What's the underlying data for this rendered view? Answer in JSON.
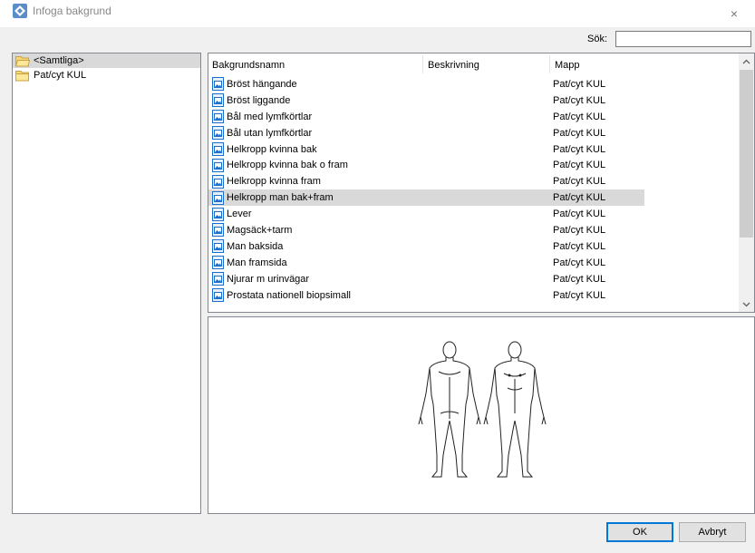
{
  "window": {
    "title": "Infoga bakgrund",
    "close_glyph": "×",
    "app_icon": "diamond-app-icon"
  },
  "search": {
    "label": "Sök:",
    "value": "",
    "placeholder": ""
  },
  "tree": {
    "items": [
      {
        "label": "<Samtliga>",
        "icon": "folder-open-icon",
        "selected": true
      },
      {
        "label": "Pat/cyt KUL",
        "icon": "folder-icon",
        "selected": false
      }
    ]
  },
  "list": {
    "columns": [
      "Bakgrundsnamn",
      "Beskrivning",
      "Mapp"
    ],
    "rows": [
      {
        "name": "Bröst hängande",
        "description": "",
        "folder": "Pat/cyt KUL"
      },
      {
        "name": "Bröst liggande",
        "description": "",
        "folder": "Pat/cyt KUL"
      },
      {
        "name": "Bål med lymfkörtlar",
        "description": "",
        "folder": "Pat/cyt KUL"
      },
      {
        "name": "Bål utan lymfkörtlar",
        "description": "",
        "folder": "Pat/cyt KUL"
      },
      {
        "name": "Helkropp kvinna bak",
        "description": "",
        "folder": "Pat/cyt KUL"
      },
      {
        "name": "Helkropp kvinna bak o fram",
        "description": "",
        "folder": "Pat/cyt KUL"
      },
      {
        "name": "Helkropp kvinna fram",
        "description": "",
        "folder": "Pat/cyt KUL"
      },
      {
        "name": "Helkropp man bak+fram",
        "description": "",
        "folder": "Pat/cyt KUL",
        "selected": true
      },
      {
        "name": "Lever",
        "description": "",
        "folder": "Pat/cyt KUL"
      },
      {
        "name": "Magsäck+tarm",
        "description": "",
        "folder": "Pat/cyt KUL"
      },
      {
        "name": "Man baksida",
        "description": "",
        "folder": "Pat/cyt KUL"
      },
      {
        "name": "Man framsida",
        "description": "",
        "folder": "Pat/cyt KUL"
      },
      {
        "name": "Njurar m urinvägar",
        "description": "",
        "folder": "Pat/cyt KUL"
      },
      {
        "name": "Prostata nationell biopsimall",
        "description": "",
        "folder": "Pat/cyt KUL"
      }
    ]
  },
  "preview": {
    "image": "male-body-back-and-front-outline"
  },
  "buttons": {
    "ok": "OK",
    "cancel": "Avbryt"
  },
  "colors": {
    "selection": "#d9d9d9",
    "ok_border": "#0078d7",
    "icon_blue": "#1e6fc9"
  }
}
